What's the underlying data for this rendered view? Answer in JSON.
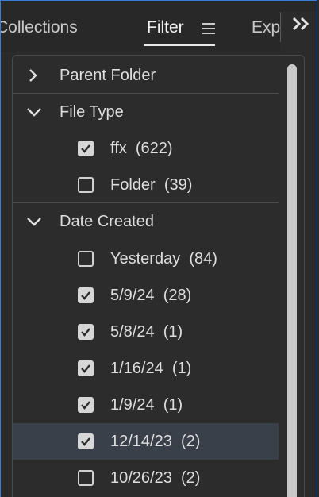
{
  "tabs": {
    "collections": "Collections",
    "filter": "Filter",
    "export": "Export"
  },
  "filter": {
    "sections": [
      {
        "label": "Parent Folder",
        "expanded": false,
        "items": []
      },
      {
        "label": "File Type",
        "expanded": true,
        "items": [
          {
            "label": "ffx",
            "count": "(622)",
            "checked": true
          },
          {
            "label": "Folder",
            "count": "(39)",
            "checked": false
          }
        ]
      },
      {
        "label": "Date Created",
        "expanded": true,
        "items": [
          {
            "label": "Yesterday",
            "count": "(84)",
            "checked": false
          },
          {
            "label": "5/9/24",
            "count": "(28)",
            "checked": true
          },
          {
            "label": "5/8/24",
            "count": "(1)",
            "checked": true
          },
          {
            "label": "1/16/24",
            "count": "(1)",
            "checked": true
          },
          {
            "label": "1/9/24",
            "count": "(1)",
            "checked": true
          },
          {
            "label": "12/14/23",
            "count": "(2)",
            "checked": true,
            "highlighted": true
          },
          {
            "label": "10/26/23",
            "count": "(2)",
            "checked": false
          }
        ]
      }
    ]
  },
  "colors": {
    "accent_border": "#3d7bd6",
    "highlight_row": "#3a404a",
    "background": "#2b2b2b"
  }
}
